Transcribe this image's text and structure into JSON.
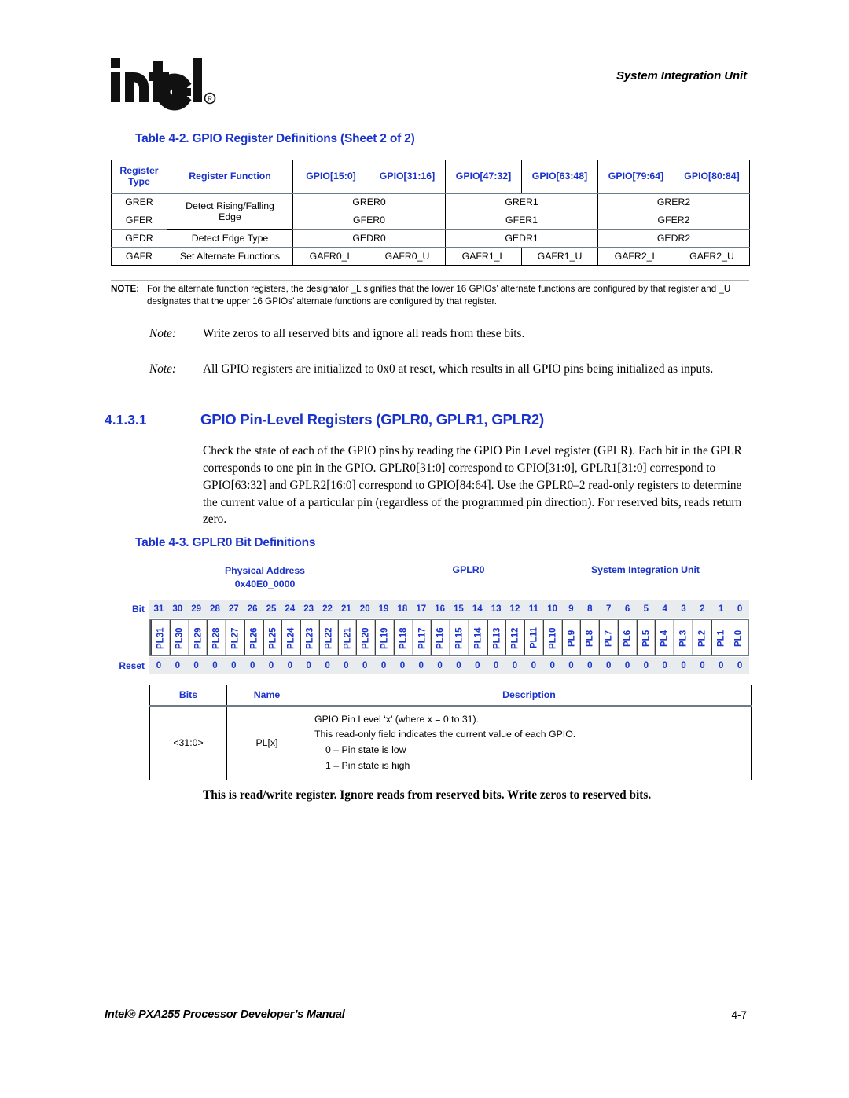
{
  "header": {
    "logo_alt": "intel",
    "running_head": "System Integration Unit"
  },
  "table_4_2": {
    "caption": "Table 4-2. GPIO Register Definitions (Sheet 2 of 2)",
    "columns": [
      "Register Type",
      "Register Function",
      "GPIO[15:0]",
      "GPIO[31:16]",
      "GPIO[47:32]",
      "GPIO[63:48]",
      "GPIO[79:64]",
      "GPIO[80:84]"
    ],
    "col_header_0_line1": "Register",
    "col_header_0_line2": "Type",
    "rows": [
      {
        "type": "GRER",
        "function": "Detect Rising/Falling Edge",
        "function_l1": "Detect Rising/Falling",
        "function_l2": "Edge",
        "c_low": "GRER0",
        "c_mid": "GRER1",
        "c_high": "GRER2"
      },
      {
        "type": "GFER",
        "c_low": "GFER0",
        "c_mid": "GFER1",
        "c_high": "GFER2"
      },
      {
        "type": "GEDR",
        "function": "Detect Edge Type",
        "c_low": "GEDR0",
        "c_mid": "GEDR1",
        "c_high": "GEDR2"
      },
      {
        "type": "GAFR",
        "function": "Set Alternate Functions",
        "c0": "GAFR0_L",
        "c1": "GAFR0_U",
        "c2": "GAFR1_L",
        "c3": "GAFR1_U",
        "c4": "GAFR2_L",
        "c5": "GAFR2_U"
      }
    ],
    "note_label": "NOTE:",
    "note_text": "For the alternate function registers, the designator _L signifies that the lower 16 GPIOs’ alternate functions are configured by that register and _U designates that the upper 16 GPIOs’ alternate functions are configured by that register."
  },
  "notes": [
    {
      "label": "Note:",
      "text": "Write zeros to all reserved bits and ignore all reads from these bits."
    },
    {
      "label": "Note:",
      "text": "All GPIO registers are initialized to 0x0 at reset, which results in all GPIO pins being initialized as inputs."
    }
  ],
  "section": {
    "number": "4.1.3.1",
    "title": "GPIO Pin-Level Registers (GPLR0, GPLR1, GPLR2)",
    "body": "Check the state of each of the GPIO pins by reading the GPIO Pin Level register (GPLR). Each bit in the GPLR corresponds to one pin in the GPIO. GPLR0[31:0] correspond to GPIO[31:0], GPLR1[31:0] correspond to GPIO[63:32] and GPLR2[16:0] correspond to GPIO[84:64]. Use the GPLR0–2 read-only registers to determine the current value of a particular pin (regardless of the programmed pin direction). For reserved bits, reads return zero."
  },
  "table_4_3": {
    "caption": "Table 4-3. GPLR0 Bit Definitions",
    "meta": {
      "physical_address_label": "Physical Address",
      "physical_address_value": "0x40E0_0000",
      "register_name": "GPLR0",
      "unit": "System Integration Unit"
    },
    "register_map": {
      "bit_row_label": "Bit",
      "reset_row_label": "Reset",
      "bits": [
        31,
        30,
        29,
        28,
        27,
        26,
        25,
        24,
        23,
        22,
        21,
        20,
        19,
        18,
        17,
        16,
        15,
        14,
        13,
        12,
        11,
        10,
        9,
        8,
        7,
        6,
        5,
        4,
        3,
        2,
        1,
        0
      ],
      "field_names": [
        "PL31",
        "PL30",
        "PL29",
        "PL28",
        "PL27",
        "PL26",
        "PL25",
        "PL24",
        "PL23",
        "PL22",
        "PL21",
        "PL20",
        "PL19",
        "PL18",
        "PL17",
        "PL16",
        "PL15",
        "PL14",
        "PL13",
        "PL12",
        "PL11",
        "PL10",
        "PL9",
        "PL8",
        "PL7",
        "PL6",
        "PL5",
        "PL4",
        "PL3",
        "PL2",
        "PL1",
        "PL0"
      ],
      "reset_values": [
        "0",
        "0",
        "0",
        "0",
        "0",
        "0",
        "0",
        "0",
        "0",
        "0",
        "0",
        "0",
        "0",
        "0",
        "0",
        "0",
        "0",
        "0",
        "0",
        "0",
        "0",
        "0",
        "0",
        "0",
        "0",
        "0",
        "0",
        "0",
        "0",
        "0",
        "0",
        "0"
      ]
    },
    "columns": [
      "Bits",
      "Name",
      "Description"
    ],
    "rows": [
      {
        "bits": "<31:0>",
        "name": "PL[x]",
        "desc_line1": "GPIO Pin Level ‘x’ (where x = 0 to 31).",
        "desc_line2": "This read-only field indicates the current value of each GPIO.",
        "desc_line3": "0 –  Pin state is low",
        "desc_line4": "1 –  Pin state is high"
      }
    ]
  },
  "closing_statement": "This is read/write register. Ignore reads from reserved bits. Write zeros to reserved bits.",
  "footer": {
    "left": "Intel® PXA255 Processor Developer’s Manual",
    "right": "4-7"
  },
  "colors": {
    "heading_blue": "#1a33cc",
    "rule_gray": "#6f7b85",
    "band_gray": "#e8ecef"
  }
}
